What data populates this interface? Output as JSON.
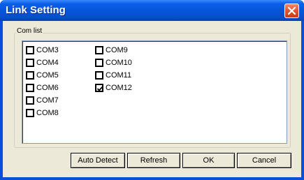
{
  "window": {
    "title": "Link Setting"
  },
  "group": {
    "label": "Com list"
  },
  "ports": [
    {
      "label": "COM3",
      "checked": false
    },
    {
      "label": "COM4",
      "checked": false
    },
    {
      "label": "COM5",
      "checked": false
    },
    {
      "label": "COM6",
      "checked": false
    },
    {
      "label": "COM7",
      "checked": false
    },
    {
      "label": "COM8",
      "checked": false
    },
    {
      "label": "COM9",
      "checked": false
    },
    {
      "label": "COM10",
      "checked": false
    },
    {
      "label": "COM11",
      "checked": false
    },
    {
      "label": "COM12",
      "checked": true
    }
  ],
  "buttons": {
    "auto_detect": "Auto Detect",
    "refresh": "Refresh",
    "ok": "OK",
    "cancel": "Cancel"
  },
  "colors": {
    "titlebar": "#0654d8",
    "client": "#ece9d8",
    "close_button": "#e05a33"
  }
}
